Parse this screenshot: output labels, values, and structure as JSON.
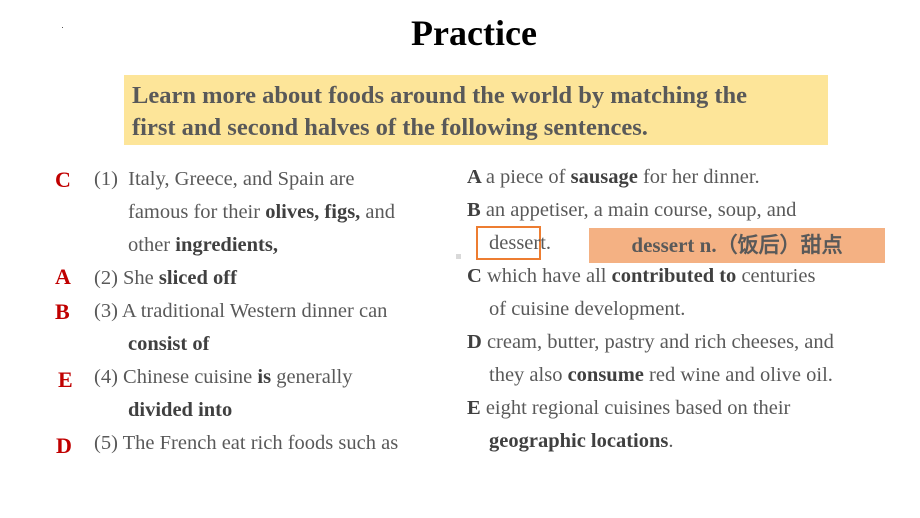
{
  "title": "Practice",
  "instruction": "Learn more about foods around the world by matching the first and second halves of the following sentences.",
  "instruction_lines": [
    "Learn more about foods around the world by matching the",
    "first and second halves of the following sentences."
  ],
  "questions": [
    {
      "answer": "C",
      "lines": [
        [
          {
            "t": "(1)  Italy, Greece, and Spain are",
            "b": false
          }
        ],
        [
          {
            "t": "famous for their ",
            "b": false
          },
          {
            "t": "olives, figs,",
            "b": true
          },
          {
            "t": " and",
            "b": false
          }
        ],
        [
          {
            "t": "other ",
            "b": false
          },
          {
            "t": "ingredients,",
            "b": true
          }
        ]
      ]
    },
    {
      "answer": "A",
      "lines": [
        [
          {
            "t": "(2) She ",
            "b": false
          },
          {
            "t": "sliced off",
            "b": true
          }
        ]
      ]
    },
    {
      "answer": "B",
      "lines": [
        [
          {
            "t": "(3) A traditional Western dinner can",
            "b": false
          }
        ],
        [
          {
            "t": "consist of",
            "b": true
          }
        ]
      ]
    },
    {
      "answer": "E",
      "lines": [
        [
          {
            "t": "(4) Chinese cuisine ",
            "b": false
          },
          {
            "t": "is",
            "b": true
          },
          {
            "t": " generally",
            "b": false
          }
        ],
        [
          {
            "t": "divided into",
            "b": true
          }
        ]
      ]
    },
    {
      "answer": "D",
      "lines": [
        [
          {
            "t": "(5) The French eat rich foods such as",
            "b": false
          }
        ]
      ]
    }
  ],
  "options": [
    {
      "letter": "A",
      "lines": [
        [
          {
            "t": "a piece of ",
            "b": false
          },
          {
            "t": "sausage",
            "b": true
          },
          {
            "t": " for her dinner.",
            "b": false
          }
        ]
      ]
    },
    {
      "letter": "B",
      "lines": [
        [
          {
            "t": "an appetiser, a main course, soup, and",
            "b": false
          }
        ]
      ]
    },
    {
      "letter": "C",
      "lines": [
        [
          {
            "t": "which have all ",
            "b": false
          },
          {
            "t": "contributed to",
            "b": true
          },
          {
            "t": " centuries",
            "b": false
          }
        ],
        [
          {
            "t": "of cuisine development.",
            "b": false
          }
        ]
      ]
    },
    {
      "letter": "D",
      "lines": [
        [
          {
            "t": "cream, butter, pastry and rich cheeses, and",
            "b": false
          }
        ],
        [
          {
            "t": "they also ",
            "b": false
          },
          {
            "t": "consume",
            "b": true
          },
          {
            "t": " red wine and olive oil.",
            "b": false
          }
        ]
      ]
    },
    {
      "letter": "E",
      "lines": [
        [
          {
            "t": "eight regional cuisines based on their",
            "b": false
          }
        ],
        [
          {
            "t": "geographic locations",
            "b": true
          },
          {
            "t": ".",
            "b": false
          }
        ]
      ]
    }
  ],
  "boxed_word": "dessert.",
  "vocab_note": {
    "en": "dessert n.",
    "cn": "（饭后）甜点"
  },
  "colors": {
    "answer": "#c00000",
    "banner": "#fde599",
    "note": "#f4b183",
    "box_border": "#ed7d31"
  }
}
